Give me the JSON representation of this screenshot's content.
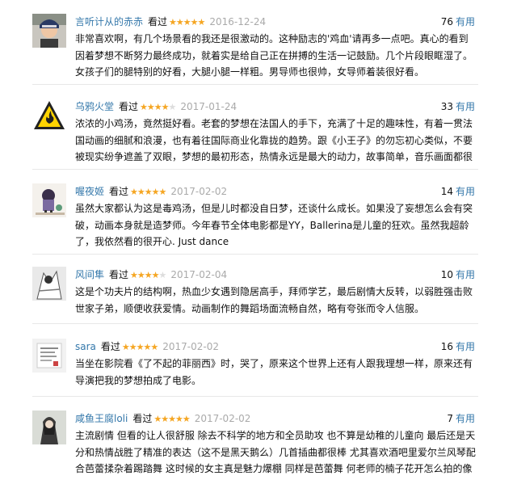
{
  "reviews": [
    {
      "user": "言听计从的赤赤",
      "seen": "看过",
      "stars": 5,
      "date": "2016-12-24",
      "useful_count": "76",
      "useful_label": "有用",
      "text": "非常喜欢啊，有几个场景看的我还是很激动的。这种励志的'鸡血'请再多一点吧。真心的看到因着梦想不断努力最终成功，就着实是给自己正在拼搏的生活一记鼓励。几个片段眼眶湿了。女孩子们的腿特别的好看，大腿小腿一样粗。男导师也很帅，女导师着装很好看。"
    },
    {
      "user": "乌鸦火堂",
      "seen": "看过",
      "stars": 4,
      "date": "2017-01-24",
      "useful_count": "33",
      "useful_label": "有用",
      "text": "浓浓的小鸡汤，竟然挺好看。老套的梦想在法国人的手下，充满了十足的趣味性，有着一贯法国动画的细腻和浪漫，也有着往国际商业化靠拢的趋势。跟《小王子》的勿忘初心类似，不要被现实纷争遮盖了双眼，梦想的最初形态，热情永远是最大的动力，故事简单，音乐画面都很赞，结尾还有小彩情"
    },
    {
      "user": "喔夜姬",
      "seen": "看过",
      "stars": 5,
      "date": "2017-02-02",
      "useful_count": "14",
      "useful_label": "有用",
      "text": "虽然大家都认为这是毒鸡汤，但是儿时都没自日梦，还谈什么成长。如果没了妄想怎么会有突破，动画本身就是造梦师。今年春节全体电影都是YY，Ballerina是儿童的狂欢。虽然我超龄了，我依然看的很开心. Just dance"
    },
    {
      "user": "风间隼",
      "seen": "看过",
      "stars": 4,
      "date": "2017-02-04",
      "useful_count": "10",
      "useful_label": "有用",
      "text": "这是个功夫片的结构啊，热血少女遇到隐居高手，拜师学艺，最后剧情大反转，以弱胜强击败世家子弟，顺便收获爱情。动画制作的舞蹈场面流畅自然，略有夸张而令人信服。"
    },
    {
      "user": "sara",
      "seen": "看过",
      "stars": 5,
      "date": "2017-02-02",
      "useful_count": "16",
      "useful_label": "有用",
      "text": "当坐在影院看《了不起的菲丽西》时，哭了，原来这个世界上还有人跟我理想一样，原来还有导演把我的梦想拍成了电影。"
    },
    {
      "user": "咸鱼王腐loli",
      "seen": "看过",
      "stars": 5,
      "date": "2017-02-02",
      "useful_count": "7",
      "useful_label": "有用",
      "text": "主流剧情 但看的让人很舒服 除去不科学的地方和全员助攻 也不算是幼稚的儿童向 最后还是天分和热情战胜了精准的表达（这不是黑天鹅么）几首插曲都很棒 尤其喜欢酒吧里爱尔兰风琴配合芭蕾揉杂着踢踏舞 这时候的女主真是魅力爆棚 同样是芭蕾舞 何老师的楠子花开怎么拍的像车祸现场……"
    }
  ],
  "more_icon": "expand-icon"
}
